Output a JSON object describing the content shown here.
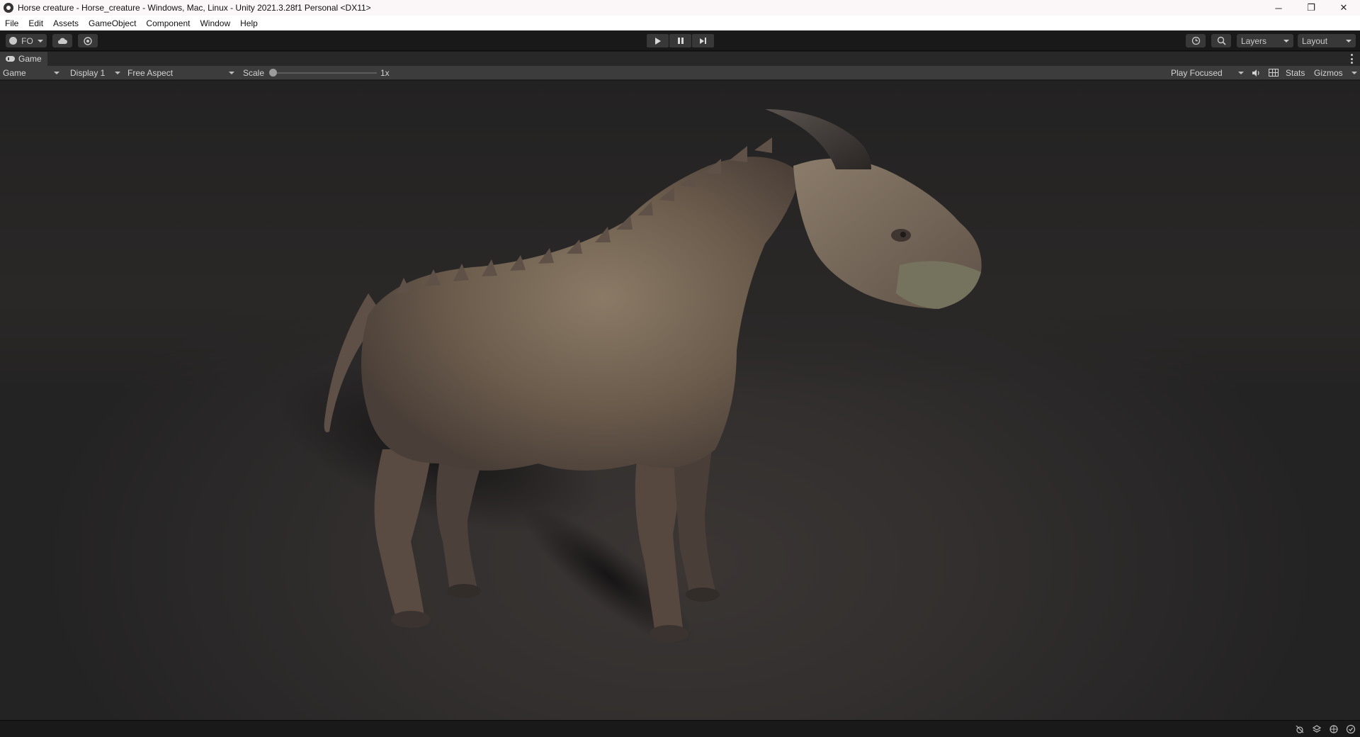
{
  "window": {
    "title": "Horse creature - Horse_creature - Windows, Mac, Linux - Unity 2021.3.28f1 Personal <DX11>",
    "minimize_glyph": "─",
    "restore_glyph": "❐",
    "close_glyph": "✕"
  },
  "menu": [
    "File",
    "Edit",
    "Assets",
    "GameObject",
    "Component",
    "Window",
    "Help"
  ],
  "toolbar": {
    "account_label": "FO",
    "layers_label": "Layers",
    "layout_label": "Layout"
  },
  "game_tab": {
    "label": "Game"
  },
  "game_view": {
    "mode": "Game",
    "display": "Display 1",
    "aspect": "Free Aspect",
    "scale_label": "Scale",
    "scale_value": "1x",
    "play_mode": "Play Focused",
    "stats_label": "Stats",
    "gizmos_label": "Gizmos"
  },
  "icons": {
    "account": "person-icon",
    "cloud": "cloud-icon",
    "collab": "collab-icon",
    "play": "play-icon",
    "pause": "pause-icon",
    "step": "step-icon",
    "history": "history-icon",
    "search": "search-icon",
    "mute": "speaker-icon",
    "stats": "grid-icon"
  },
  "colors": {
    "editor_dark": "#191919",
    "panel": "#3c3c3c",
    "creature_skin": "#7a6a58",
    "horn": "#3a3533"
  }
}
